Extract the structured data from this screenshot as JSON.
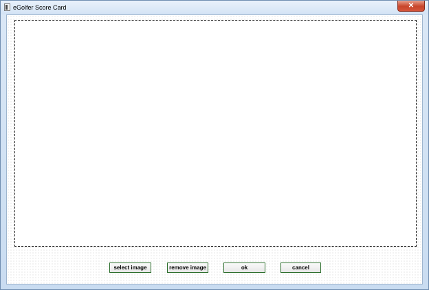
{
  "window": {
    "title": "eGolfer Score Card",
    "close_glyph": "✕",
    "icon": "app-window-icon"
  },
  "buttons": {
    "select_image": "select image",
    "remove_image": "remove image",
    "ok": "ok",
    "cancel": "cancel"
  },
  "colors": {
    "title_bar": "#d3e3f5",
    "close_button": "#c7452b",
    "button_border": "#2c6e2c"
  }
}
